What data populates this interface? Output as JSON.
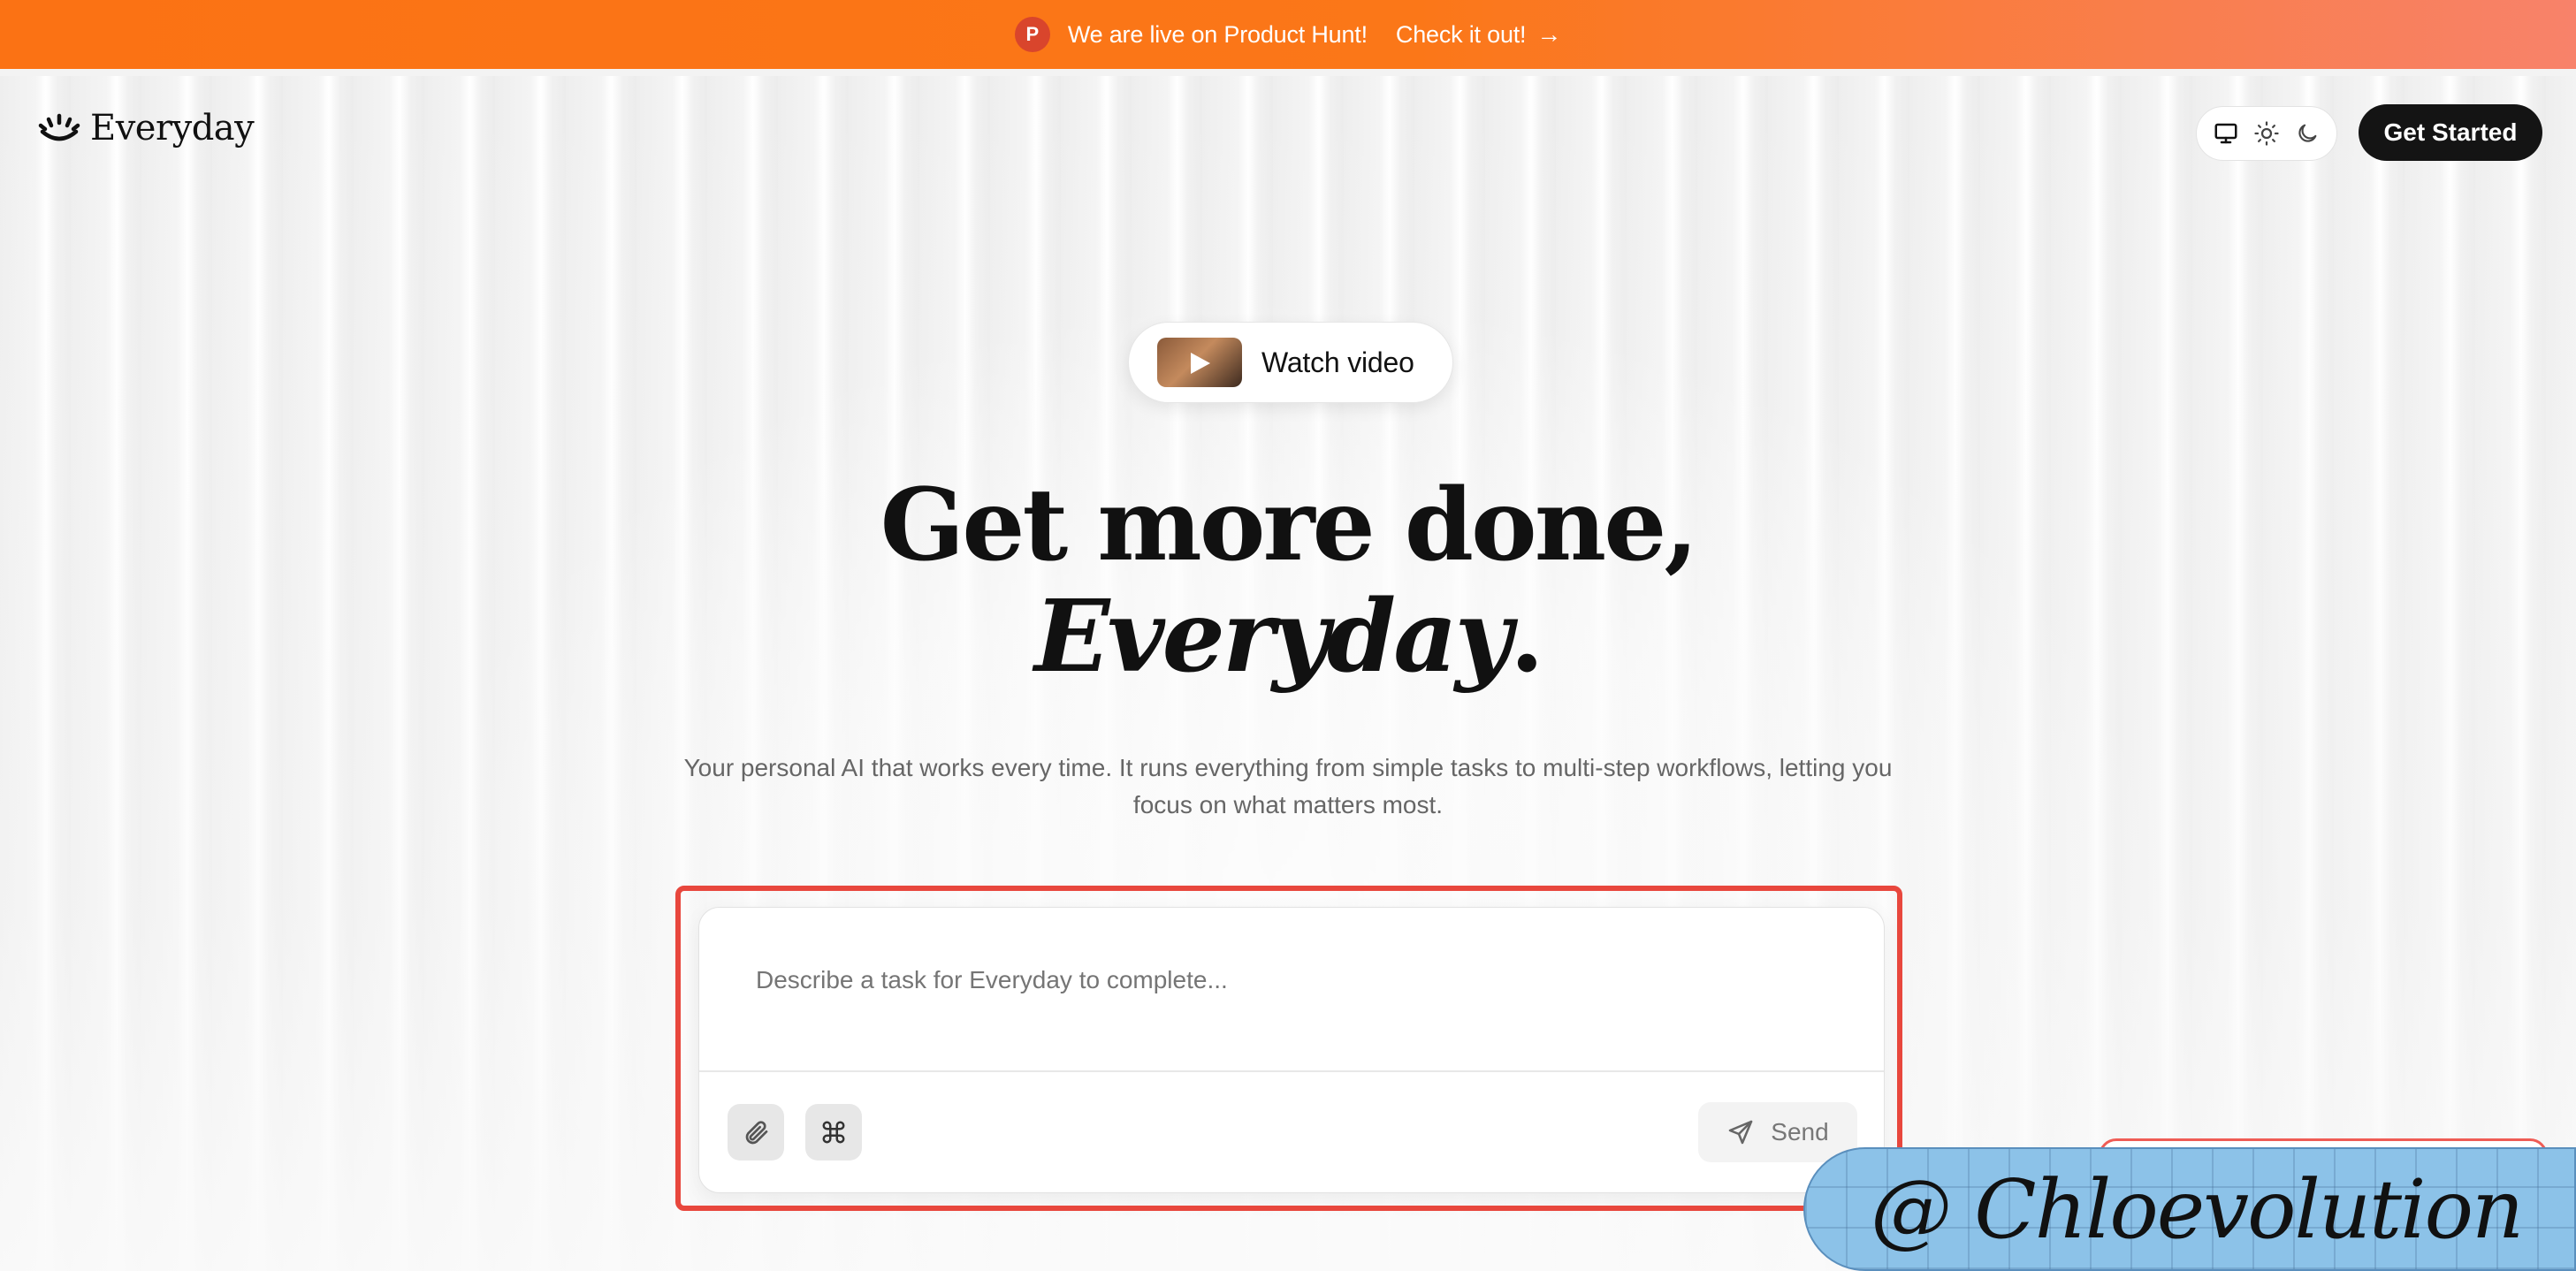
{
  "announcement": {
    "badge": "P",
    "text": "We are live on Product Hunt!",
    "link": "Check it out!",
    "arrow": "→"
  },
  "nav": {
    "brand": "Everyday",
    "theme_options": [
      "monitor-icon",
      "sun-icon",
      "moon-icon"
    ],
    "cta": "Get Started"
  },
  "watch_video": {
    "label": "Watch video"
  },
  "hero": {
    "line1": "Get more done,",
    "line2_italic": "Everyday",
    "line2_suffix": ".",
    "subtitle": "Your personal AI that works every time. It runs everything from simple tasks to multi-step workflows, letting you focus on what matters most."
  },
  "task": {
    "placeholder": "Describe a task for Everyday to complete...",
    "attach_icon": "paperclip-icon",
    "command_icon": "command-icon",
    "send_label": "Send"
  },
  "watermark": {
    "text": "@ Chloevolution"
  },
  "colors": {
    "banner_start": "#fb7214",
    "banner_end": "#f8826a",
    "highlight": "#e8473d",
    "cta_bg": "#141414"
  }
}
